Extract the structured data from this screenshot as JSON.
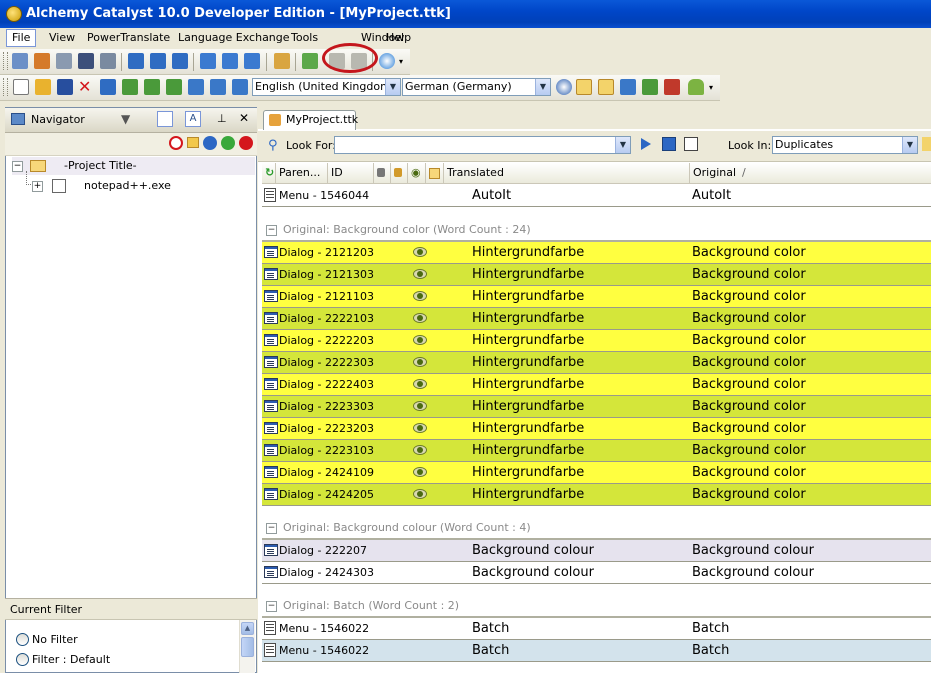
{
  "window": {
    "title": "Alchemy Catalyst 10.0 Developer Edition - [MyProject.ttk]"
  },
  "menubar": [
    "File",
    "View",
    "PowerTranslate",
    "Language Exchange",
    "Tools",
    "Window",
    "Help"
  ],
  "toolbar": {
    "source_language": "English (United Kingdom)",
    "target_language": "German (Germany)"
  },
  "navigator": {
    "title": "Navigator",
    "tree": {
      "root": "-Project Title-",
      "child": "notepad++.exe"
    }
  },
  "filter": {
    "title": "Current Filter",
    "options": [
      "No Filter",
      "Filter : Default"
    ]
  },
  "document": {
    "tab": "MyProject.ttk",
    "look_for_label": "Look For:",
    "look_for_value": "",
    "look_in_label": "Look In:",
    "look_in_value": "Duplicates"
  },
  "grid": {
    "columns": [
      "Paren...",
      "ID",
      "Translated",
      "Original"
    ],
    "sort_indicator": "/",
    "top_row": {
      "id": "Menu - 1546044",
      "translated": "AutoIt",
      "original": "AutoIt"
    },
    "groups": [
      {
        "label": "Original: Background color (Word Count : 24)",
        "rows": [
          {
            "id": "Dialog - 2121203",
            "translated": "Hintergrundfarbe",
            "original": "Background color"
          },
          {
            "id": "Dialog - 2121303",
            "translated": "Hintergrundfarbe",
            "original": "Background color"
          },
          {
            "id": "Dialog - 2121103",
            "translated": "Hintergrundfarbe",
            "original": "Background color"
          },
          {
            "id": "Dialog - 2222103",
            "translated": "Hintergrundfarbe",
            "original": "Background color"
          },
          {
            "id": "Dialog - 2222203",
            "translated": "Hintergrundfarbe",
            "original": "Background color"
          },
          {
            "id": "Dialog - 2222303",
            "translated": "Hintergrundfarbe",
            "original": "Background color"
          },
          {
            "id": "Dialog - 2222403",
            "translated": "Hintergrundfarbe",
            "original": "Background color"
          },
          {
            "id": "Dialog - 2223303",
            "translated": "Hintergrundfarbe",
            "original": "Background color"
          },
          {
            "id": "Dialog - 2223203",
            "translated": "Hintergrundfarbe",
            "original": "Background color"
          },
          {
            "id": "Dialog - 2223103",
            "translated": "Hintergrundfarbe",
            "original": "Background color"
          },
          {
            "id": "Dialog - 2424109",
            "translated": "Hintergrundfarbe",
            "original": "Background color"
          },
          {
            "id": "Dialog - 2424205",
            "translated": "Hintergrundfarbe",
            "original": "Background color"
          }
        ]
      },
      {
        "label": "Original: Background colour (Word Count : 4)",
        "rows": [
          {
            "id": "Dialog - 222207",
            "translated": "Background colour",
            "original": "Background colour"
          },
          {
            "id": "Dialog - 2424303",
            "translated": "Background colour",
            "original": "Background colour"
          }
        ]
      },
      {
        "label": "Original: Batch (Word Count : 2)",
        "rows": [
          {
            "id": "Menu - 1546022",
            "translated": "Batch",
            "original": "Batch"
          },
          {
            "id": "Menu - 1546022",
            "translated": "Batch",
            "original": "Batch"
          }
        ]
      }
    ]
  },
  "colors": {
    "duplicate_yellow": "#FFFF40",
    "duplicate_lime": "#D4E63A",
    "highlight_circle": "#C4161C"
  }
}
